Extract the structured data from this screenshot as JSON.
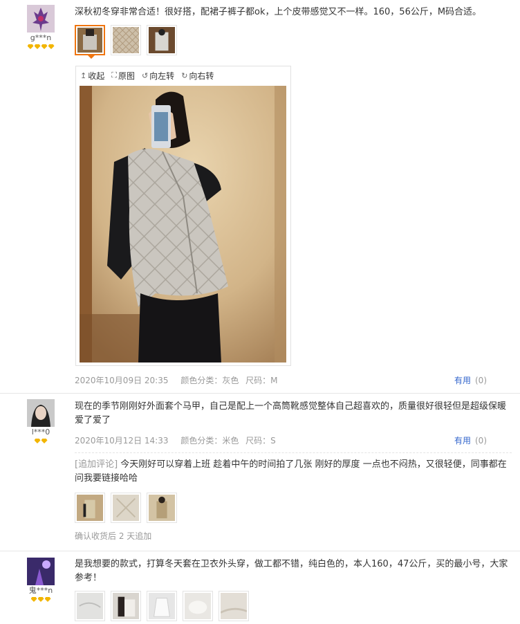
{
  "reviews": [
    {
      "user": "g***n",
      "gems": 4,
      "text": "深秋初冬穿非常合适！很好搭，配裙子裤子都ok，上个皮带感觉又不一样。160，56公斤，M码合适。",
      "viewer": {
        "collapse": "收起",
        "original": "原图",
        "rotate_left": "向左转",
        "rotate_right": "向右转"
      },
      "date": "2020年10月09日 20:35",
      "color": "颜色分类：灰色",
      "size": "尺码：M",
      "useful_label": "有用",
      "useful_count": "(0)"
    },
    {
      "user": "l***0",
      "gems": 2,
      "text": "现在的季节刚刚好外面套个马甲，自己是配上一个高筒靴感觉整体自己超喜欢的，质量很好很轻但是超级保暖 爱了爱了",
      "date": "2020年10月12日 14:33",
      "color": "颜色分类：米色",
      "size": "尺码：S",
      "useful_label": "有用",
      "useful_count": "(0)",
      "addon_label": "[追加评论]",
      "addon_text": "今天刚好可以穿着上班 趁着中午的时间拍了几张 刚好的厚度 一点也不闷热，又很轻便，同事都在问我要链接哈哈",
      "addon_note": "确认收货后 2 天追加"
    },
    {
      "user": "鬼***n",
      "gems": 3,
      "text": "是我想要的款式，打算冬天套在卫衣外头穿，做工都不错，纯白色的，本人160，47公斤，买的最小号，大家参考！"
    }
  ],
  "colors": {
    "accent": "#f0750f",
    "link": "#3366cc",
    "gem": "#f2b500",
    "meta": "#999999"
  }
}
